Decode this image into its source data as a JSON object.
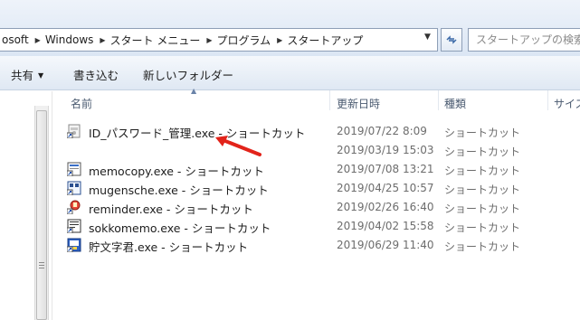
{
  "address_bar": {
    "crumbs": [
      "osoft",
      "Windows",
      "スタート メニュー",
      "プログラム",
      "スタートアップ"
    ],
    "search_placeholder": "スタートアップの検索"
  },
  "toolbar": {
    "share_label": "共有",
    "burn_label": "書き込む",
    "new_folder_label": "新しいフォルダー"
  },
  "columns": {
    "name": "名前",
    "modified": "更新日時",
    "type": "種類",
    "size": "サイズ"
  },
  "files": [
    {
      "name": "ID_パスワード_管理.exe - ショートカット",
      "date": "2019/07/22 8:09",
      "type": "ショートカット"
    },
    {
      "name": "",
      "date": "2019/03/19 15:03",
      "type": "ショートカット"
    },
    {
      "name": "memocopy.exe - ショートカット",
      "date": "2019/07/08 13:21",
      "type": "ショートカット"
    },
    {
      "name": "mugensche.exe - ショートカット",
      "date": "2019/04/25 10:57",
      "type": "ショートカット"
    },
    {
      "name": "reminder.exe - ショートカット",
      "date": "2019/02/26 16:40",
      "type": "ショートカット"
    },
    {
      "name": "sokkomemo.exe - ショートカット",
      "date": "2019/04/02 15:58",
      "type": "ショートカット"
    },
    {
      "name": "貯文字君.exe - ショートカット",
      "date": "2019/06/29 11:40",
      "type": "ショートカット"
    }
  ],
  "icons": {
    "refresh": "refresh-icon",
    "dropdown": "chevron-down-icon",
    "annotation": "red-arrow-annotation",
    "shortcut": "shortcut-file-icon"
  },
  "colors": {
    "annotation_arrow": "#e2231a",
    "chrome_gradient_top": "#f5f8fc",
    "chrome_gradient_bottom": "#dfe8f3",
    "secondary_text": "#6d6d6d"
  }
}
